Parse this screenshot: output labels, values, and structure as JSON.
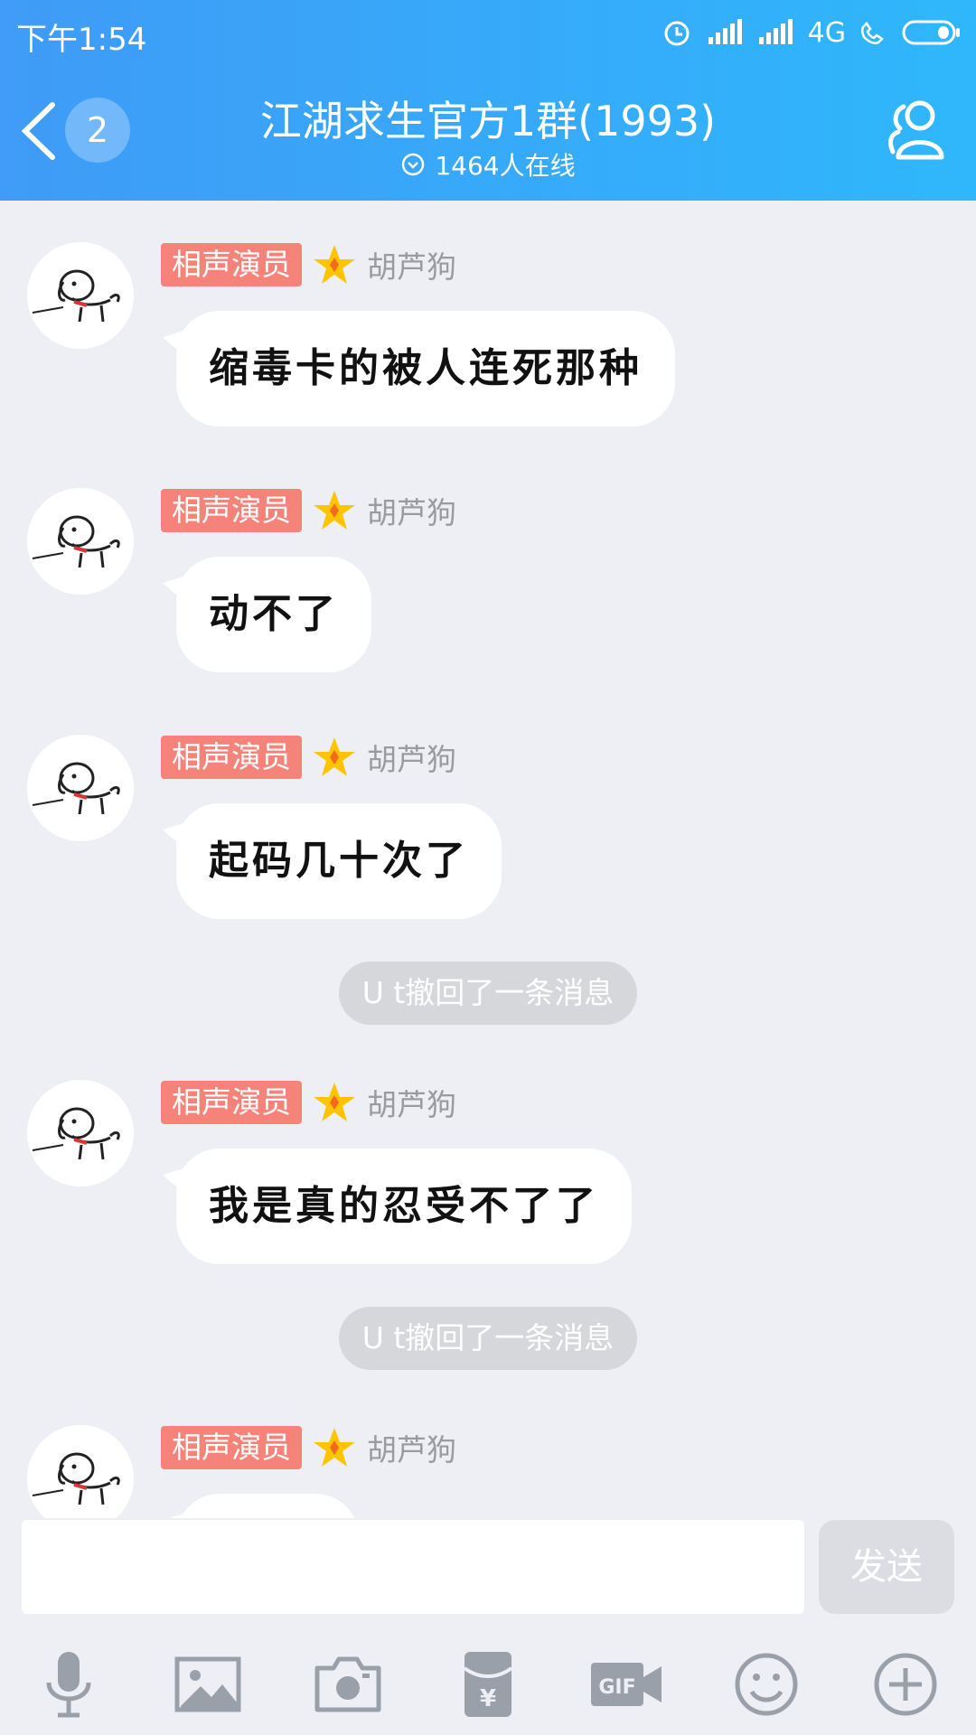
{
  "status_bar": {
    "time": "下午1:54",
    "network": "4G"
  },
  "header": {
    "unread_count": "2",
    "title": "江湖求生官方1群(1993)",
    "online": "1464人在线"
  },
  "messages": [
    {
      "tag": "相声演员",
      "sender": "胡芦狗",
      "text": "缩毒卡的被人连死那种"
    },
    {
      "tag": "相声演员",
      "sender": "胡芦狗",
      "text": "动不了"
    },
    {
      "tag": "相声演员",
      "sender": "胡芦狗",
      "text": "起码几十次了"
    },
    {
      "notice": "U t撤回了一条消息"
    },
    {
      "tag": "相声演员",
      "sender": "胡芦狗",
      "text": "我是真的忍受不了了"
    },
    {
      "notice": "U t撤回了一条消息"
    },
    {
      "tag": "相声演员",
      "sender": "胡芦狗",
      "text": ""
    }
  ],
  "input": {
    "send_label": "发送"
  },
  "toolbar": [
    "microphone-icon",
    "image-icon",
    "camera-icon",
    "red-packet-icon",
    "gif-icon",
    "emoji-icon",
    "plus-icon"
  ],
  "colors": {
    "header_start": "#3f9bf7",
    "header_end": "#2fb7fb",
    "tag": "#f6837a",
    "background": "#eeeff5"
  }
}
